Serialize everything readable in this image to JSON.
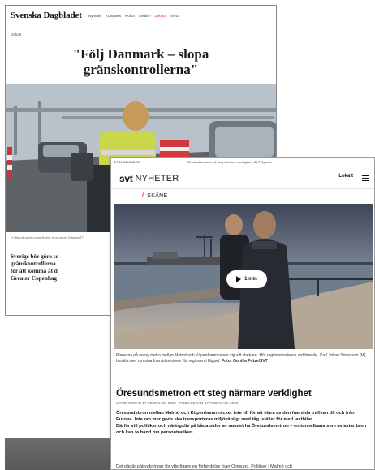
{
  "svd": {
    "logo": "Svenska Dagbladet",
    "nav": [
      "Nyheter",
      "Kompass",
      "Kultur",
      "Ledare",
      "Debatt",
      "eSvD"
    ],
    "section": "Debatt",
    "headline_line1": "\"Följ Danmark – slopa",
    "headline_line2": "gränskontrollerna\"",
    "caption": "Er åktvoll uscho burg flrerke rr m Johan Nilsson/TT",
    "lead_lines": [
      "Sverige bör göra so",
      "gränskontrollerna",
      "för att komma åt d",
      "Greater Copenhag"
    ],
    "accent_color": "#d71e52"
  },
  "svt": {
    "meta_date": "27.11.2023 12:53",
    "meta_title": "Öresundsmetron ett steg närmare verklighet | SVT Nyheter",
    "logo": "svt",
    "logo_suffix": "NYHETER",
    "lokalt": "Lokalt",
    "region": "SKÅNE",
    "play_label": "1 min",
    "caption_text": "Planerna på en ny metro mellan Malmö och Köpenhamn växer sig allt starkare. Hör regionstyrelsens ordförande, Carl Johan Sonesson (M), berätta mer om sina framtidsvisioner för regionen i klippet.",
    "caption_photo": "Foto: Gunilla Fritze/SVT",
    "title": "Öresundsmetron ett steg närmare verklighet",
    "updated": "UPPDATERAD 17 FEBRUARI 2023",
    "published": "PUBLICERAD 17 FEBRUARI 2023",
    "lead_p1": "Öresundsbron mellan Malmö och Köpenhamn räcker inte till för att klara av den framtida trafiken till och från Europa. Inte om mer gods ska transporteras miljövänligt med tåg istället för med lastbilar.",
    "lead_p2": "Därför vill politiker och näringsliv på båda sidor av sundet ha Öresundsmetron – en tunnelbana som avlastar bron och kan ta hand om persontrafiken.",
    "body": "Det pågår påtryckningar för ytterligare en förbindelse över Öresund. Politiker i Malmö och",
    "accent_color": "#e0195f"
  }
}
